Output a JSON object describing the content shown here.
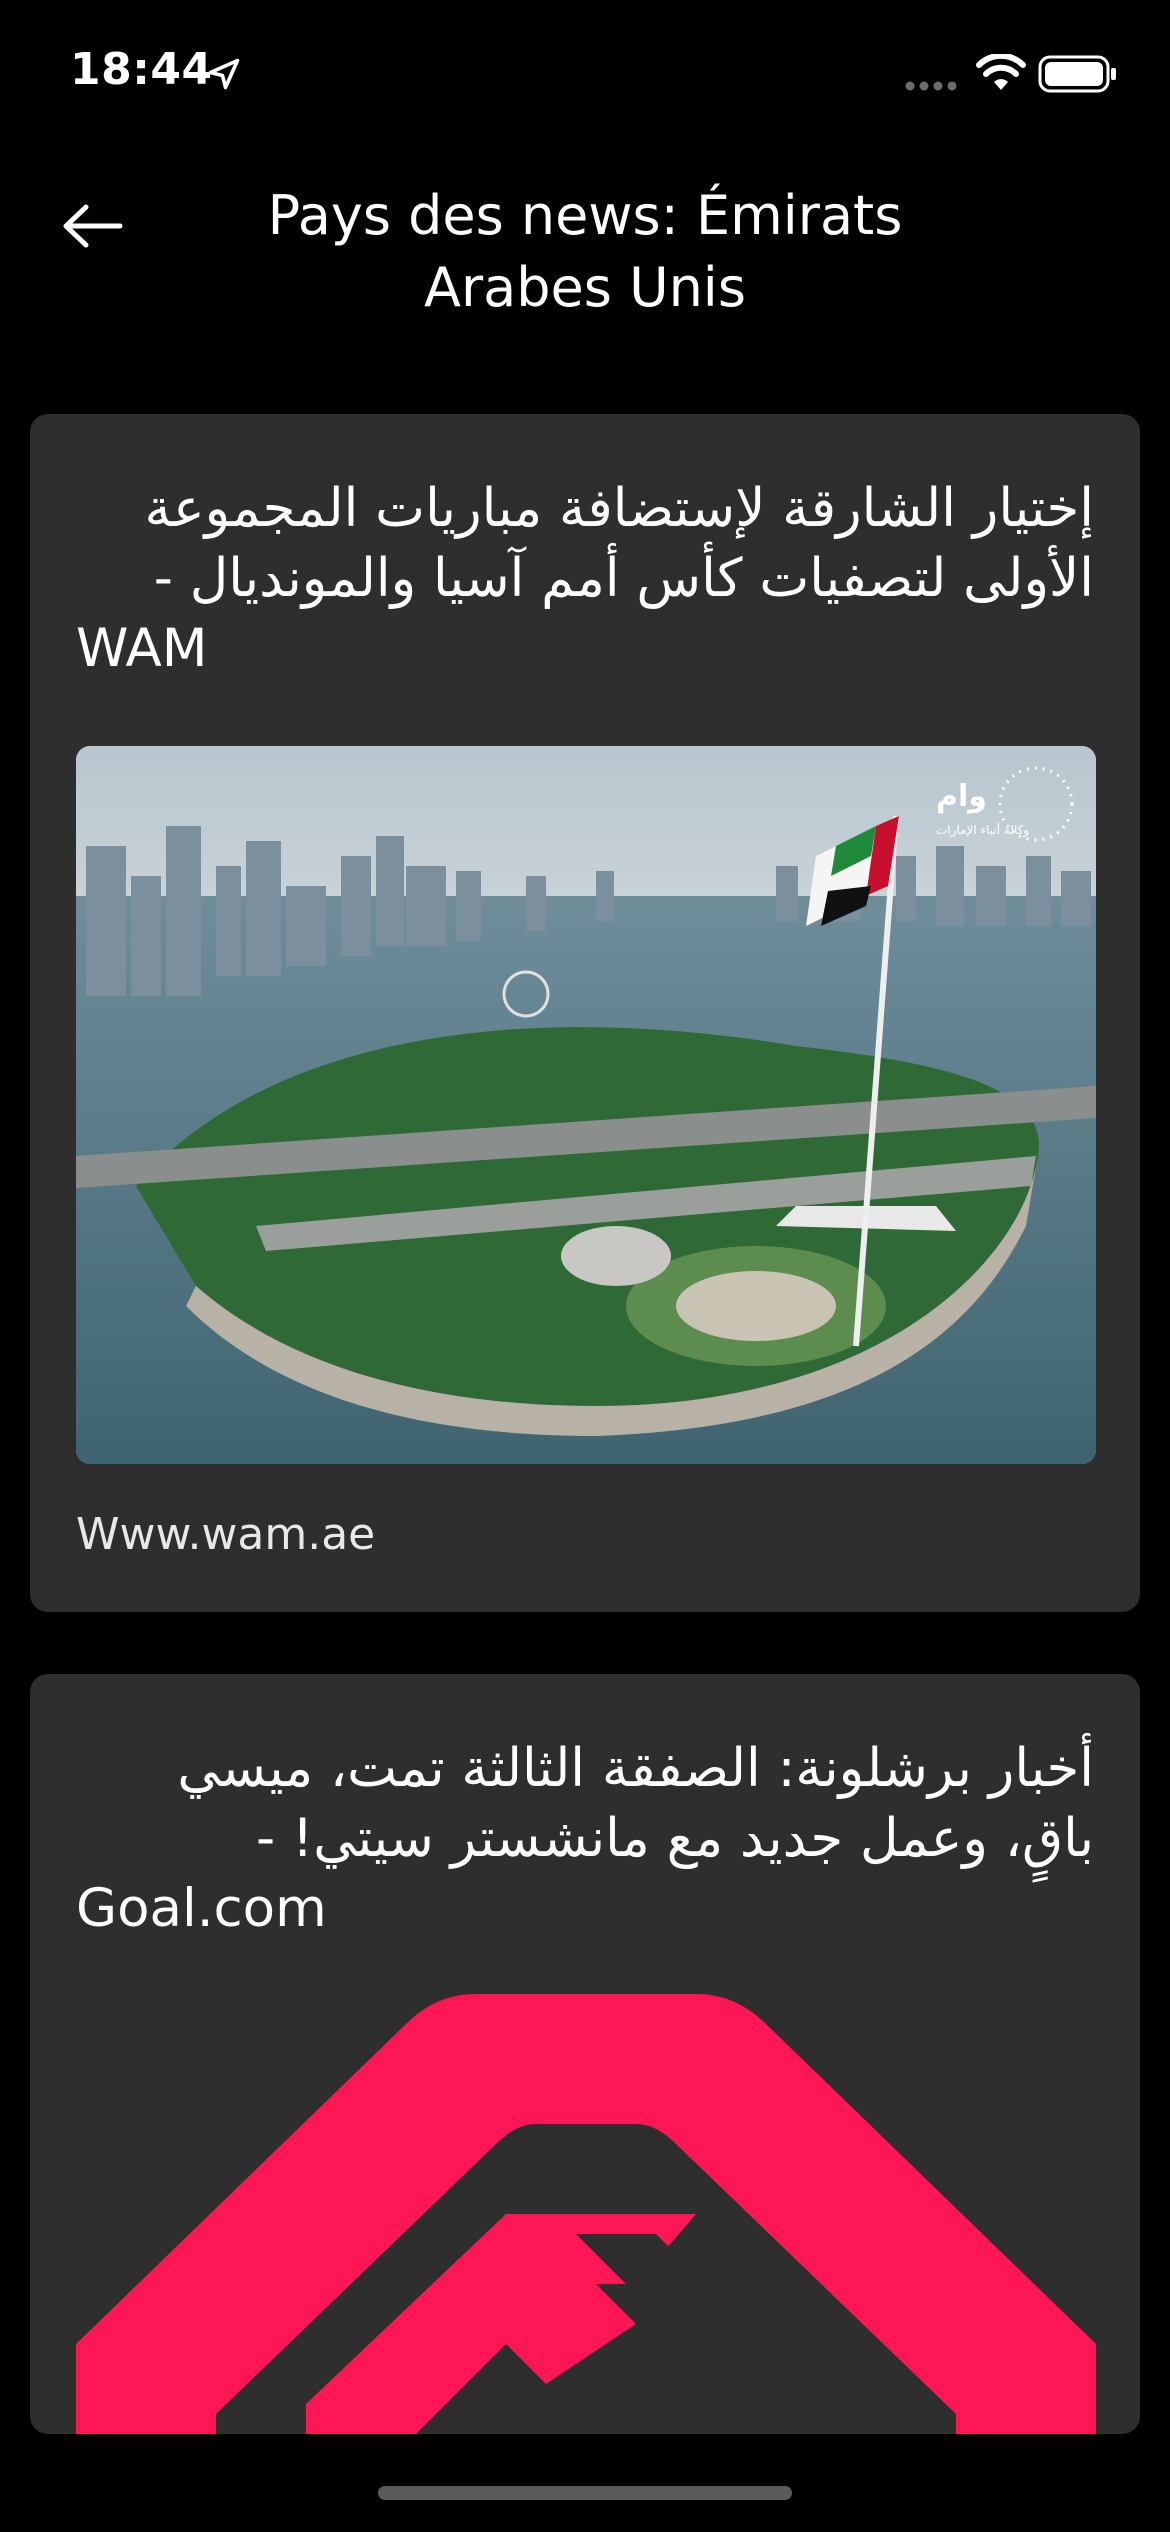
{
  "status_bar": {
    "time": "18:44"
  },
  "header": {
    "title": "Pays des news: Émirats Arabes Unis",
    "back_icon": "arrow-left-icon"
  },
  "articles": [
    {
      "title_ar": "إختيار الشارقة لإستضافة مباريات المجموعة الأولى لتصفيات كأس أمم آسيا والمونديال -",
      "title_suffix": "WAM",
      "source": "Www.wam.ae",
      "image_logo_text": "وام",
      "image_logo_subtext": "وكالة أنباء الإمارات"
    },
    {
      "title_ar": "أخبار برشلونة: الصفقة الثالثة تمت، ميسي باقٍ، وعمل جديد مع مانشستر سيتي! -",
      "title_suffix": "Goal.com"
    }
  ],
  "colors": {
    "background": "#000000",
    "card": "#2e2e2e",
    "text": "#ffffff",
    "goal_logo": "#ff1654"
  }
}
